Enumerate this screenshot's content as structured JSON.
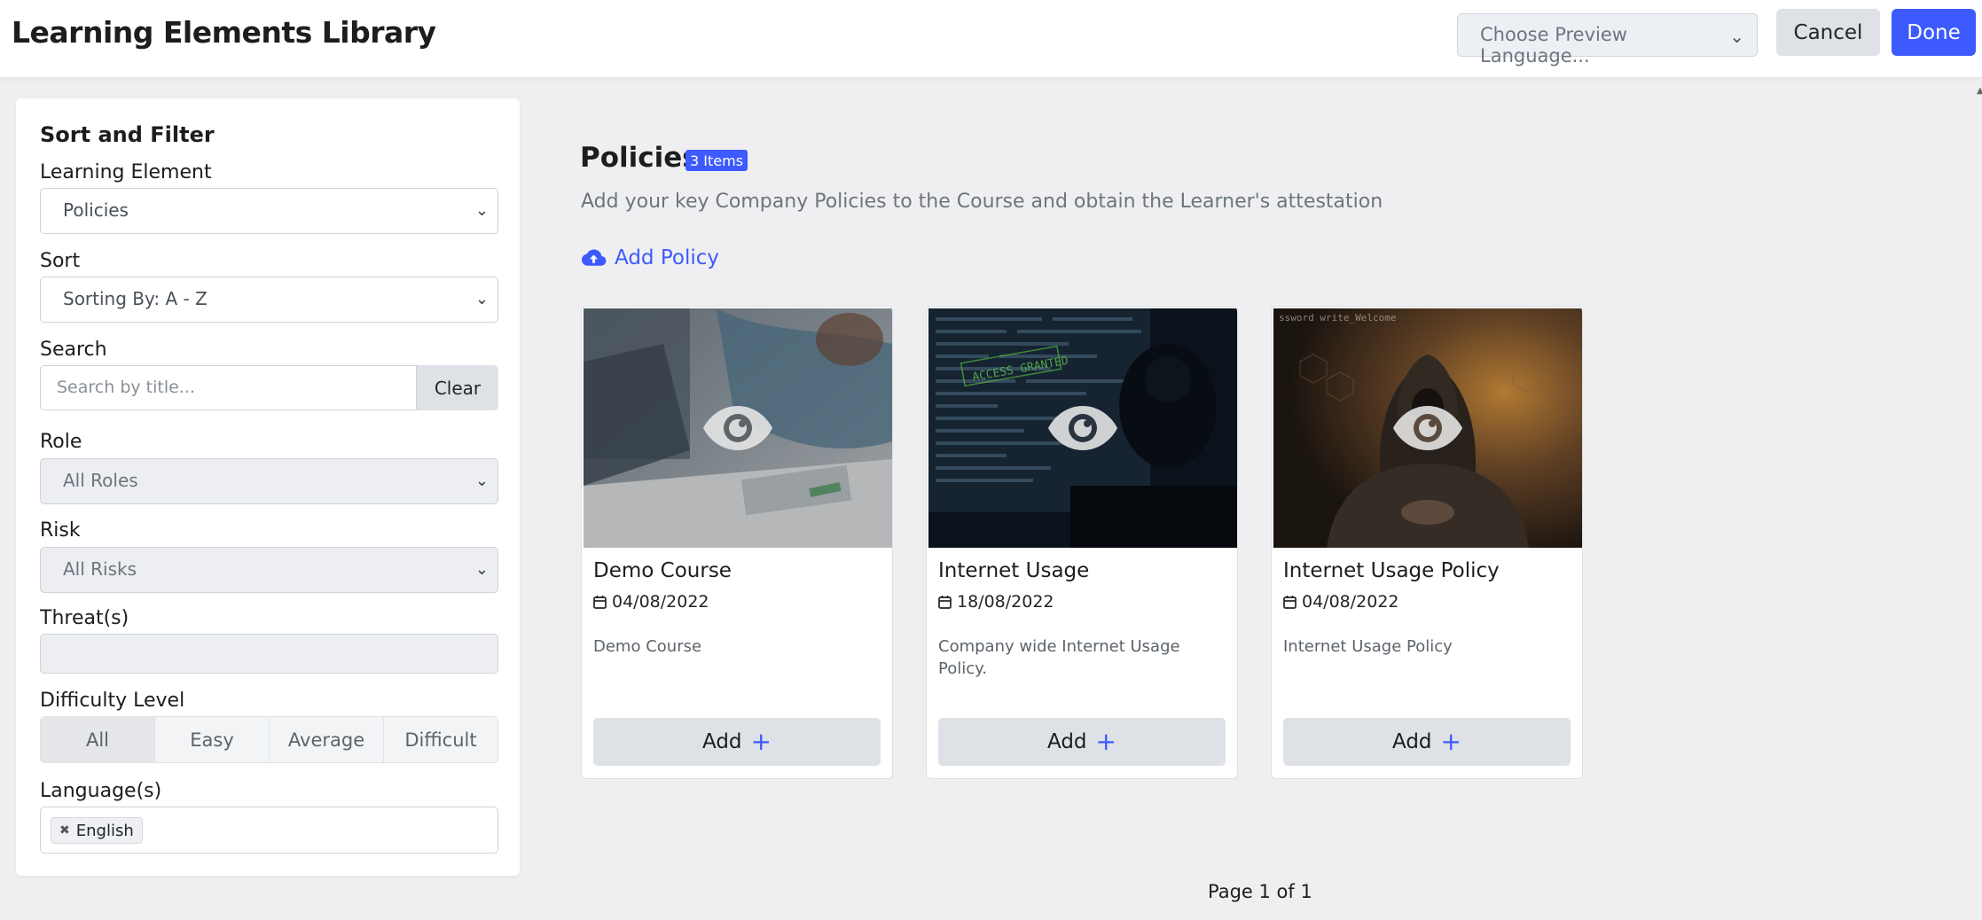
{
  "header": {
    "title": "Learning Elements Library",
    "preview_language_placeholder": "Choose Preview Language...",
    "cancel_label": "Cancel",
    "done_label": "Done"
  },
  "sidebar": {
    "title": "Sort and Filter",
    "learning_element": {
      "label": "Learning Element",
      "value": "Policies"
    },
    "sort": {
      "label": "Sort",
      "value": "Sorting By: A - Z"
    },
    "search": {
      "label": "Search",
      "placeholder": "Search by title...",
      "clear_label": "Clear"
    },
    "role": {
      "label": "Role",
      "value": "All Roles"
    },
    "risk": {
      "label": "Risk",
      "value": "All Risks"
    },
    "threats": {
      "label": "Threat(s)",
      "value": ""
    },
    "difficulty": {
      "label": "Difficulty Level",
      "options": [
        "All",
        "Easy",
        "Average",
        "Difficult"
      ],
      "selected": "All"
    },
    "languages": {
      "label": "Language(s)",
      "tags": [
        "English"
      ]
    }
  },
  "main": {
    "section_title": "Policies",
    "item_count_badge": "3 Items",
    "description": "Add your key Company Policies to the Course and obtain the Learner's attestation",
    "add_policy_label": "Add Policy",
    "cards": [
      {
        "title": "Demo Course",
        "date": "04/08/2022",
        "description": "Demo Course",
        "add_label": "Add",
        "theme": "office"
      },
      {
        "title": "Internet Usage",
        "date": "18/08/2022",
        "description": "Company wide Internet Usage Policy.",
        "add_label": "Add",
        "theme": "terminal"
      },
      {
        "title": "Internet Usage Policy",
        "date": "04/08/2022",
        "description": "Internet Usage Policy",
        "add_label": "Add",
        "theme": "hacker"
      }
    ],
    "pagination": "Page 1 of 1"
  },
  "colors": {
    "accent": "#3d5afe",
    "background": "#efeff1",
    "button_gray": "#dee1e6"
  },
  "icons": {
    "preview": "eye-icon",
    "date": "calendar-icon",
    "upload": "cloud-upload-icon",
    "add": "plus-icon",
    "remove_tag": "close-icon"
  }
}
